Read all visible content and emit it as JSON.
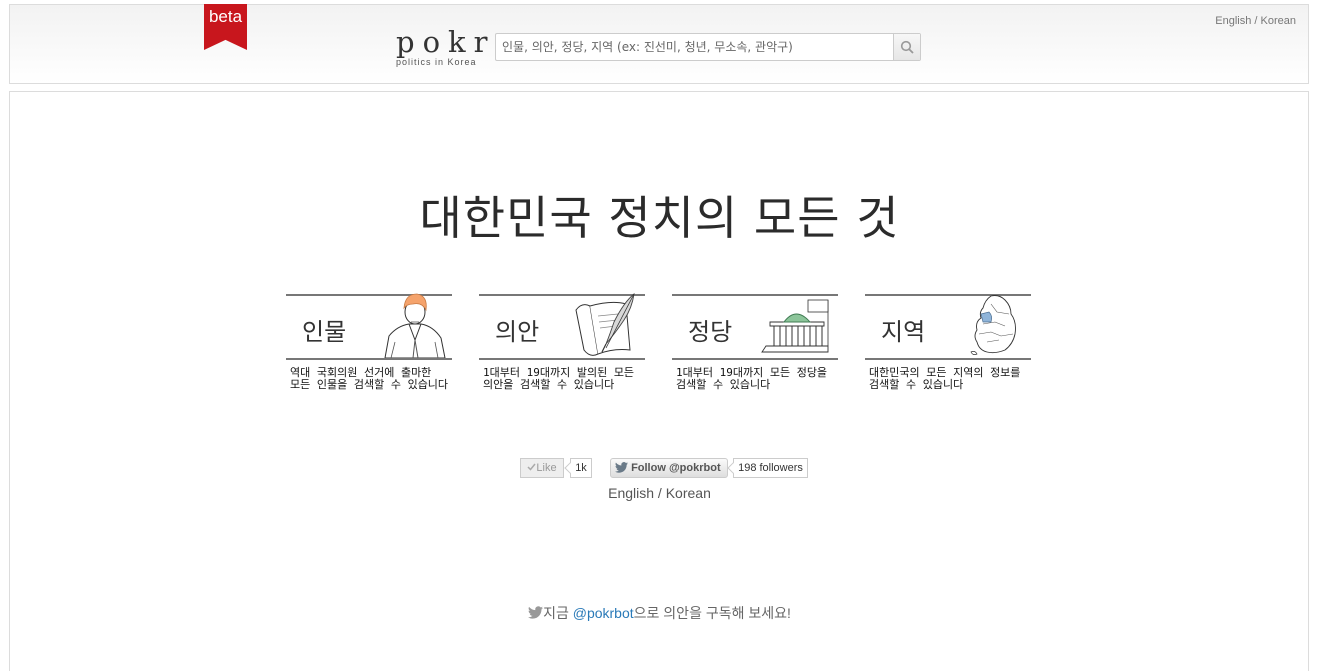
{
  "header": {
    "beta_label": "beta",
    "logo_main": "pokr",
    "logo_sub": "politics in Korea",
    "search_placeholder": "인물, 의안, 정당, 지역 (ex: 진선미, 청년, 무소속, 관악구)",
    "lang_english": "English",
    "lang_sep": " / ",
    "lang_korean": "Korean"
  },
  "hero": {
    "title": "대한민국 정치의 모든 것"
  },
  "categories": [
    {
      "label": "인물",
      "desc": "역대 국회의원 선거에 출마한\n모든 인물을 검색할 수 있습니다"
    },
    {
      "label": "의안",
      "desc": "1대부터 19대까지 발의된 모든\n의안을 검색할 수 있습니다"
    },
    {
      "label": "정당",
      "desc": "1대부터 19대까지 모든 정당을\n검색할 수 있습니다"
    },
    {
      "label": "지역",
      "desc": "대한민국의 모든 지역의 정보를\n검색할 수 있습니다"
    }
  ],
  "social": {
    "like_label": "Like",
    "like_count": "1k",
    "follow_label": "Follow @pokrbot",
    "followers": "198 followers"
  },
  "footer": {
    "lang_english": "English",
    "lang_sep": " / ",
    "lang_korean": "Korean",
    "subscribe_prefix": "지금 ",
    "subscribe_handle": "@pokrbot",
    "subscribe_suffix": "으로 의안을 구독해 보세요!"
  },
  "colors": {
    "beta_red": "#c8161d",
    "link_blue": "#2a7ab8"
  },
  "icons": [
    "search-icon",
    "check-icon",
    "twitter-bird-icon"
  ]
}
